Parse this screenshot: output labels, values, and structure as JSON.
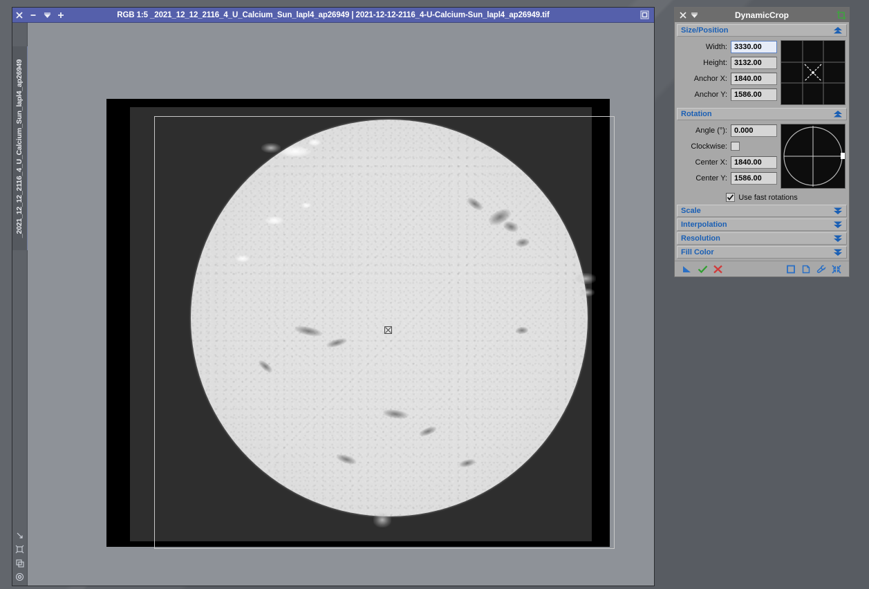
{
  "desktop": {
    "bg_color": "#62666c"
  },
  "image_window": {
    "title": "RGB 1:5 _2021_12_12_2116_4_U_Calcium_Sun_lapl4_ap26949 | 2021-12-12-2116_4-U-Calcium-Sun_lapl4_ap26949.tif",
    "titlebar_color": "#5560ab",
    "controls": [
      {
        "name": "close-button",
        "icon": "close-icon",
        "glyph": "✕"
      },
      {
        "name": "minimize-button",
        "icon": "minimize-icon",
        "glyph": "–"
      },
      {
        "name": "shade-button",
        "icon": "shade-icon",
        "glyph": "⧉"
      },
      {
        "name": "maximize-button",
        "icon": "plus-icon",
        "glyph": "＋"
      }
    ],
    "restore_button": {
      "name": "restore-window-button",
      "icon": "restore-icon"
    },
    "vertical_tab": {
      "label": "_2021_12_12_2116_4_U_Calcium_Sun_lapl4_ap26949",
      "accent_color": "#6f7a9c"
    },
    "sidebar_icons": [
      {
        "name": "zoom-to-fit-icon",
        "title": "Zoom to fit"
      },
      {
        "name": "expand-icon",
        "title": "Expand"
      },
      {
        "name": "duplicate-icon",
        "title": "Duplicate"
      },
      {
        "name": "target-icon",
        "title": "Target"
      }
    ],
    "image": {
      "description": "Calcium K line solar disk, grayscale",
      "background_color": "#000000",
      "plate_color": "#2e2e2e",
      "selection_color": "#c9c9c9",
      "center_marker": "crop-center-marker"
    }
  },
  "dynamic_crop": {
    "title": "DynamicCrop",
    "titlebar_color": "#6d6d6d",
    "panel_color": "#a8a8a8",
    "accent_color": "#1a5fb4",
    "titlebar_controls": [
      {
        "name": "dc-close-button",
        "icon": "close-icon",
        "glyph": "✕"
      },
      {
        "name": "dc-shade-button",
        "icon": "shade-icon",
        "glyph": "⧉"
      }
    ],
    "process_icon": {
      "name": "dynamiccrop-process-icon",
      "color": "#3fa43f"
    },
    "sections": [
      {
        "id": "size-position",
        "label": "Size/Position",
        "expanded": true,
        "arrow": "collapse-arrow-icon",
        "fields": [
          {
            "name": "width-input",
            "label": "Width:",
            "value": "3330.00",
            "focused": true
          },
          {
            "name": "height-input",
            "label": "Height:",
            "value": "3132.00",
            "focused": false
          },
          {
            "name": "anchor-x-input",
            "label": "Anchor X:",
            "value": "1840.00",
            "focused": false
          },
          {
            "name": "anchor-y-input",
            "label": "Anchor Y:",
            "value": "1586.00",
            "focused": false
          }
        ],
        "widget": "anchor-grid-widget"
      },
      {
        "id": "rotation",
        "label": "Rotation",
        "expanded": true,
        "arrow": "collapse-arrow-icon",
        "fields": [
          {
            "name": "angle-input",
            "label": "Angle (°):",
            "value": "0.000",
            "focused": false
          },
          {
            "name": "clockwise-checkbox",
            "label": "Clockwise:",
            "type": "checkbox",
            "checked": false
          },
          {
            "name": "center-x-input",
            "label": "Center X:",
            "value": "1840.00",
            "focused": false
          },
          {
            "name": "center-y-input",
            "label": "Center Y:",
            "value": "1586.00",
            "focused": false
          }
        ],
        "widget": "rotation-dial-widget",
        "fast_rotations": {
          "name": "use-fast-rotations-checkbox",
          "label": "Use fast rotations",
          "checked": true
        }
      }
    ],
    "collapsed_sections": [
      {
        "id": "scale",
        "label": "Scale",
        "arrow": "expand-arrow-icon"
      },
      {
        "id": "interpolation",
        "label": "Interpolation",
        "arrow": "expand-arrow-icon"
      },
      {
        "id": "resolution",
        "label": "Resolution",
        "arrow": "expand-arrow-icon"
      },
      {
        "id": "fill-color",
        "label": "Fill Color",
        "arrow": "expand-arrow-icon"
      }
    ],
    "toolbar": {
      "left": [
        {
          "name": "apply-to-view-button",
          "icon": "blue-triangle-icon",
          "color": "#2a6fc4"
        },
        {
          "name": "apply-global-button",
          "icon": "green-check-icon",
          "color": "#2f9e2f"
        },
        {
          "name": "cancel-button",
          "icon": "red-x-icon",
          "color": "#d13a3a"
        }
      ],
      "right": [
        {
          "name": "browse-instances-button",
          "icon": "square-icon",
          "color": "#2a6fc4"
        },
        {
          "name": "new-instance-button",
          "icon": "document-icon",
          "color": "#2a6fc4"
        },
        {
          "name": "preferences-button",
          "icon": "wrench-icon",
          "color": "#2a6fc4"
        },
        {
          "name": "collapse-button",
          "icon": "collapse-all-icon",
          "color": "#2a6fc4"
        }
      ]
    }
  }
}
